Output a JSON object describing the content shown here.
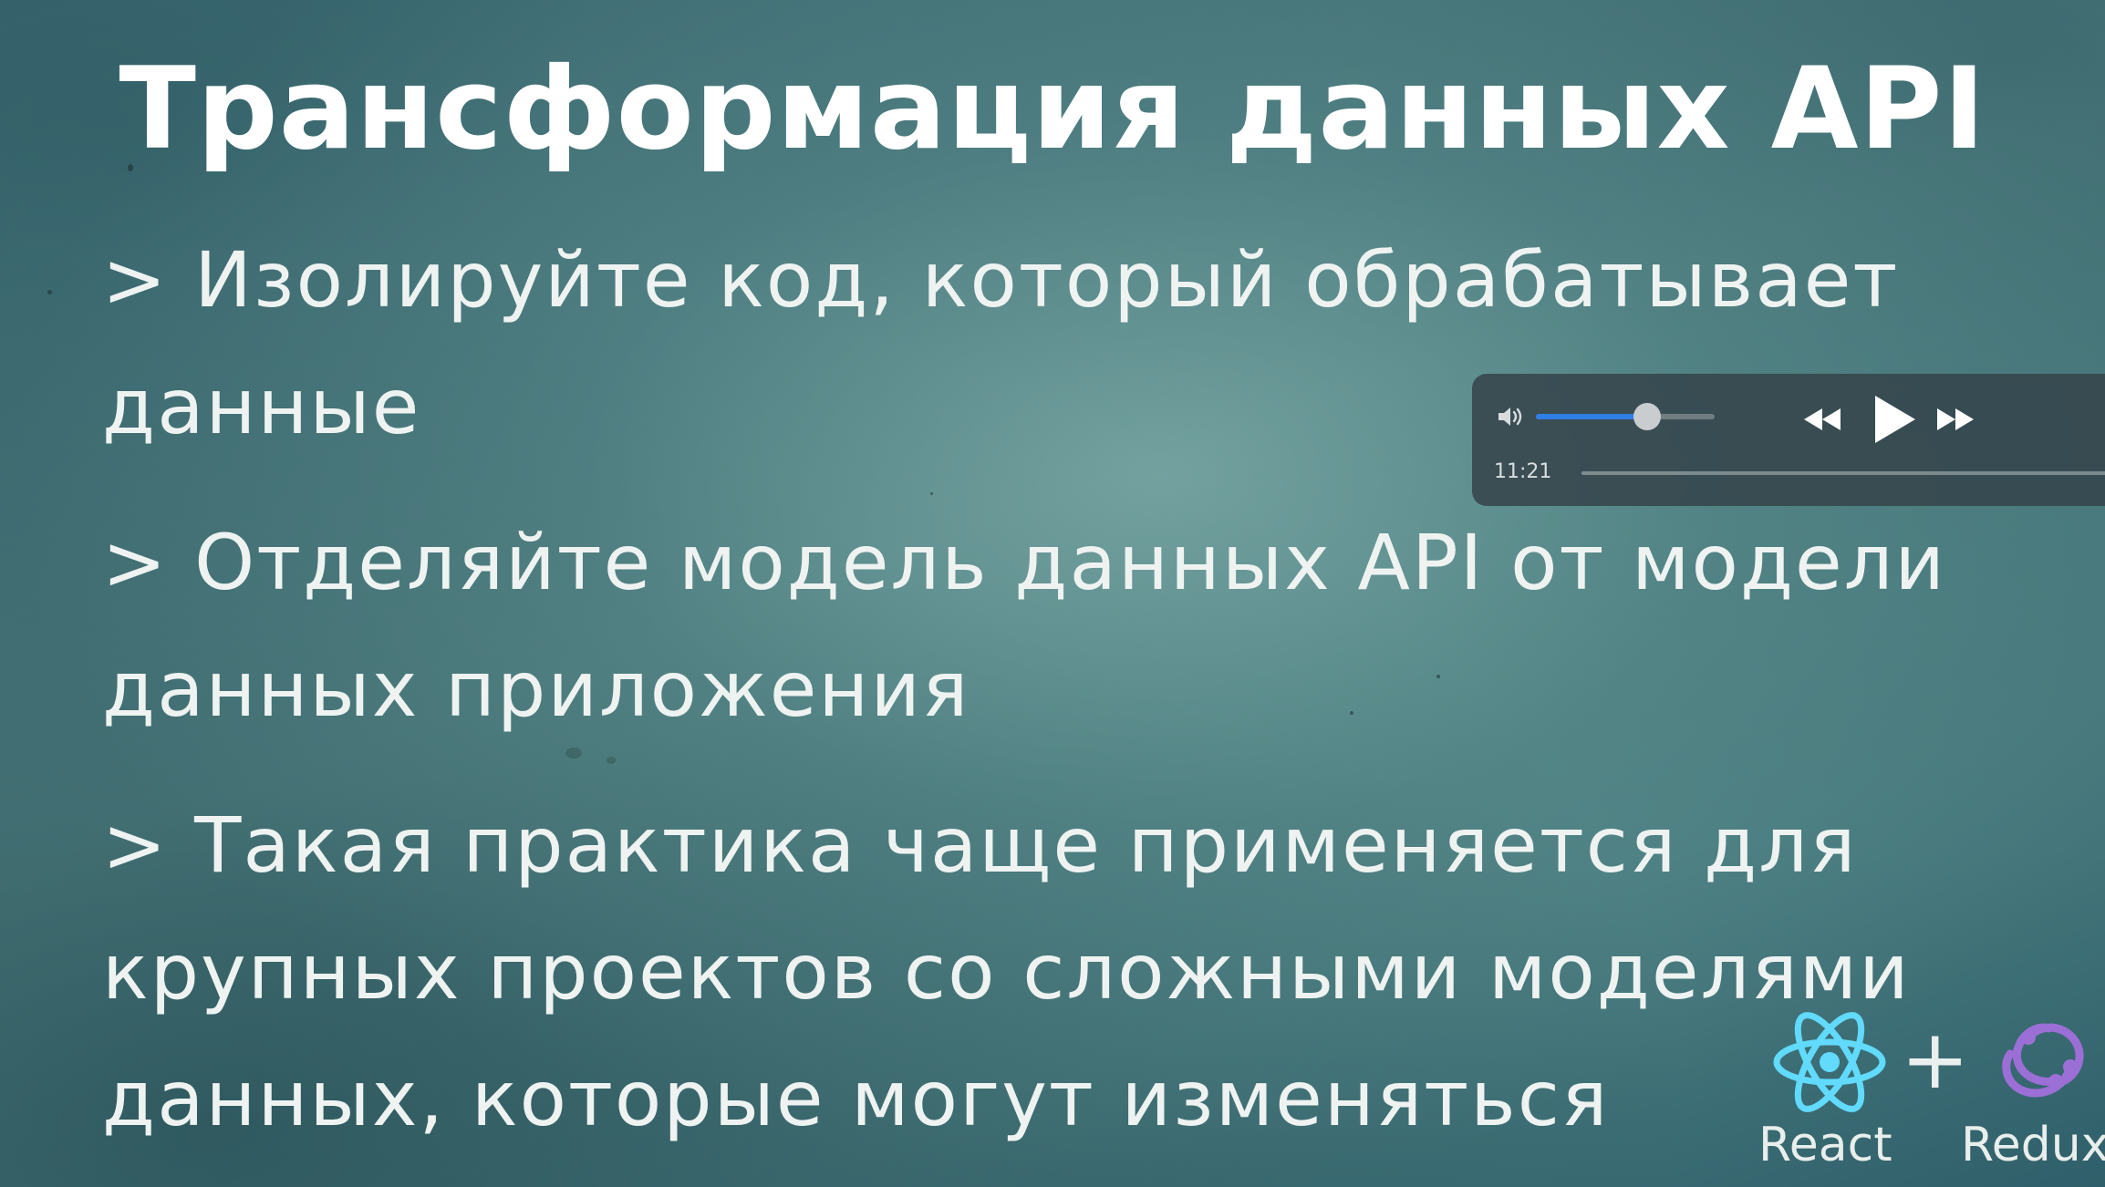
{
  "slide": {
    "title": "Трансформация данных API",
    "bullets": [
      "> Изолируйте код, который обрабатывает данные",
      "> Отделяйте модель данных API от модели данных приложения",
      "> Такая практика чаще применяется для крупных проектов со сложными моделями данных, которые могут изменяться"
    ]
  },
  "player": {
    "time": "11:21",
    "volume_level": 0.62,
    "icons": {
      "volume": "volume-icon",
      "rewind": "rewind-icon",
      "play": "play-icon",
      "forward": "fast-forward-icon"
    },
    "accent": "#2f7fe6"
  },
  "logos": {
    "react_label": "React",
    "plus": "+",
    "redux_label": "Redux",
    "react_color": "#61dafb",
    "redux_color": "#9b6fd6"
  }
}
